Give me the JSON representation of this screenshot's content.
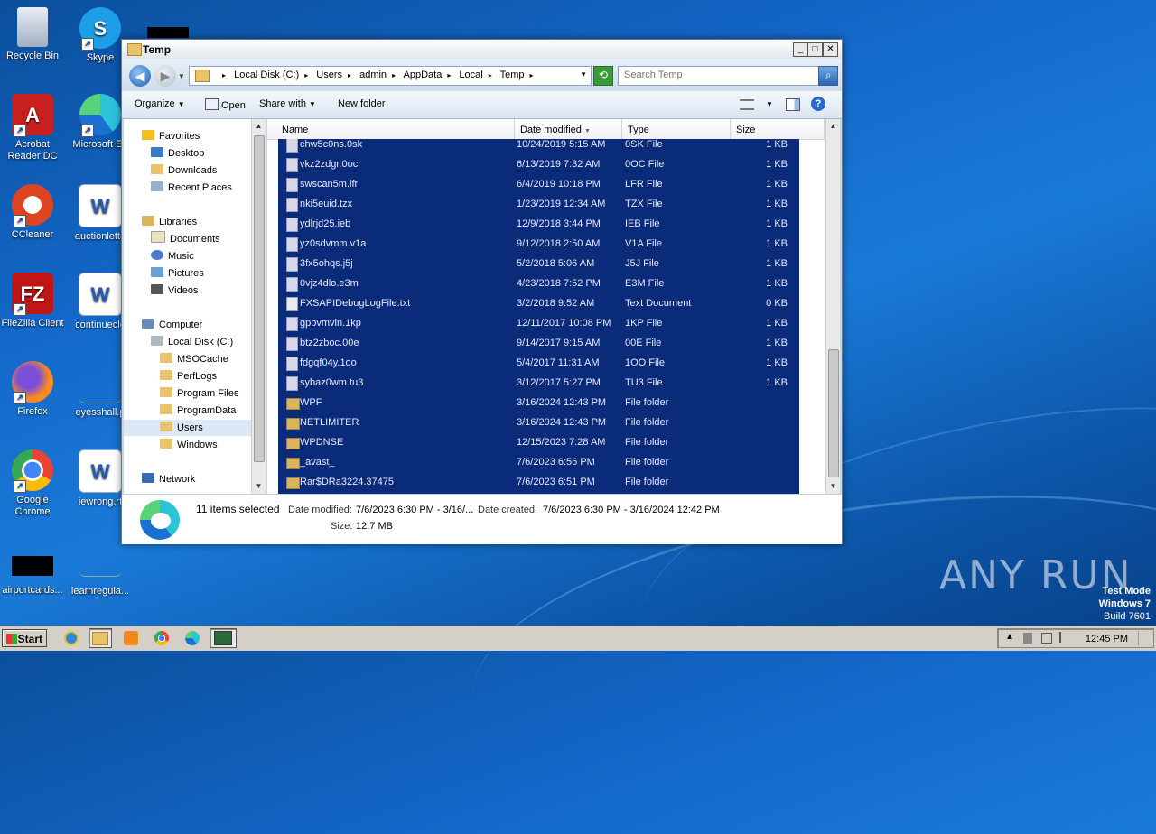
{
  "desktop": {
    "icons": [
      {
        "label": "Recycle Bin"
      },
      {
        "label": "Skype"
      },
      {
        "label": "Acrobat Reader DC"
      },
      {
        "label": "Microsoft Ed"
      },
      {
        "label": "CCleaner"
      },
      {
        "label": "auctionlette"
      },
      {
        "label": "FileZilla Client"
      },
      {
        "label": "continuecle"
      },
      {
        "label": "Firefox"
      },
      {
        "label": "eyesshall.p"
      },
      {
        "label": "Google Chrome"
      },
      {
        "label": "iewrong.rt"
      },
      {
        "label": "airportcards..."
      },
      {
        "label": "learnregula..."
      }
    ]
  },
  "window": {
    "title": "Temp",
    "breadcrumbs": [
      "Local Disk (C:)",
      "Users",
      "admin",
      "AppData",
      "Local",
      "Temp"
    ],
    "search_placeholder": "Search Temp",
    "toolbar": {
      "organize": "Organize",
      "open": "Open",
      "share_with": "Share with",
      "new_folder": "New folder"
    },
    "nav": {
      "favorites": "Favorites",
      "desktop": "Desktop",
      "downloads": "Downloads",
      "recent_places": "Recent Places",
      "libraries": "Libraries",
      "documents": "Documents",
      "music": "Music",
      "pictures": "Pictures",
      "videos": "Videos",
      "computer": "Computer",
      "local_disk": "Local Disk (C:)",
      "msocache": "MSOCache",
      "perflogs": "PerfLogs",
      "program_files": "Program Files",
      "programdata": "ProgramData",
      "users": "Users",
      "windows": "Windows",
      "network": "Network"
    },
    "columns": {
      "name": "Name",
      "date": "Date modified",
      "type": "Type",
      "size": "Size"
    },
    "files": [
      {
        "name": "chw5c0ns.0sk",
        "date": "10/24/2019 5:15 AM",
        "type": "0SK File",
        "size": "1 KB",
        "kind": "file"
      },
      {
        "name": "vkz2zdgr.0oc",
        "date": "6/13/2019 7:32 AM",
        "type": "0OC File",
        "size": "1 KB",
        "kind": "file"
      },
      {
        "name": "swscan5m.lfr",
        "date": "6/4/2019 10:18 PM",
        "type": "LFR File",
        "size": "1 KB",
        "kind": "file"
      },
      {
        "name": "nki5euid.tzx",
        "date": "1/23/2019 12:34 AM",
        "type": "TZX File",
        "size": "1 KB",
        "kind": "file"
      },
      {
        "name": "ydlrjd25.ieb",
        "date": "12/9/2018 3:44 PM",
        "type": "IEB File",
        "size": "1 KB",
        "kind": "file"
      },
      {
        "name": "yz0sdvmm.v1a",
        "date": "9/12/2018 2:50 AM",
        "type": "V1A File",
        "size": "1 KB",
        "kind": "file"
      },
      {
        "name": "3fx5ohqs.j5j",
        "date": "5/2/2018 5:06 AM",
        "type": "J5J File",
        "size": "1 KB",
        "kind": "file"
      },
      {
        "name": "0vjz4dlo.e3m",
        "date": "4/23/2018 7:52 PM",
        "type": "E3M File",
        "size": "1 KB",
        "kind": "file"
      },
      {
        "name": "FXSAPIDebugLogFile.txt",
        "date": "3/2/2018 9:52 AM",
        "type": "Text Document",
        "size": "0 KB",
        "kind": "txt"
      },
      {
        "name": "gpbvmvln.1kp",
        "date": "12/11/2017 10:08 PM",
        "type": "1KP File",
        "size": "1 KB",
        "kind": "file"
      },
      {
        "name": "btz2zboc.00e",
        "date": "9/14/2017 9:15 AM",
        "type": "00E File",
        "size": "1 KB",
        "kind": "file"
      },
      {
        "name": "fdgqf04y.1oo",
        "date": "5/4/2017 11:31 AM",
        "type": "1OO File",
        "size": "1 KB",
        "kind": "file"
      },
      {
        "name": "sybaz0wm.tu3",
        "date": "3/12/2017 5:27 PM",
        "type": "TU3 File",
        "size": "1 KB",
        "kind": "file"
      },
      {
        "name": "WPF",
        "date": "3/16/2024 12:43 PM",
        "type": "File folder",
        "size": "",
        "kind": "folder"
      },
      {
        "name": "NETLIMITER",
        "date": "3/16/2024 12:43 PM",
        "type": "File folder",
        "size": "",
        "kind": "folder"
      },
      {
        "name": "WPDNSE",
        "date": "12/15/2023 7:28 AM",
        "type": "File folder",
        "size": "",
        "kind": "folder"
      },
      {
        "name": "_avast_",
        "date": "7/6/2023 6:56 PM",
        "type": "File folder",
        "size": "",
        "kind": "folder"
      },
      {
        "name": "Rar$DRa3224.37475",
        "date": "7/6/2023 6:51 PM",
        "type": "File folder",
        "size": "",
        "kind": "folder"
      }
    ],
    "details": {
      "count": "11 items selected",
      "modified_label": "Date modified:",
      "modified_value": "7/6/2023 6:30 PM - 3/16/...",
      "created_label": "Date created:",
      "created_value": "7/6/2023 6:30 PM - 3/16/2024 12:42 PM",
      "size_label": "Size:",
      "size_value": "12.7 MB"
    }
  },
  "taskbar": {
    "start": "Start",
    "clock": "12:45 PM"
  },
  "watermark": {
    "brand": "ANY RUN",
    "line1": "Test Mode",
    "line2": "Windows 7",
    "line3": "Build 7601"
  }
}
